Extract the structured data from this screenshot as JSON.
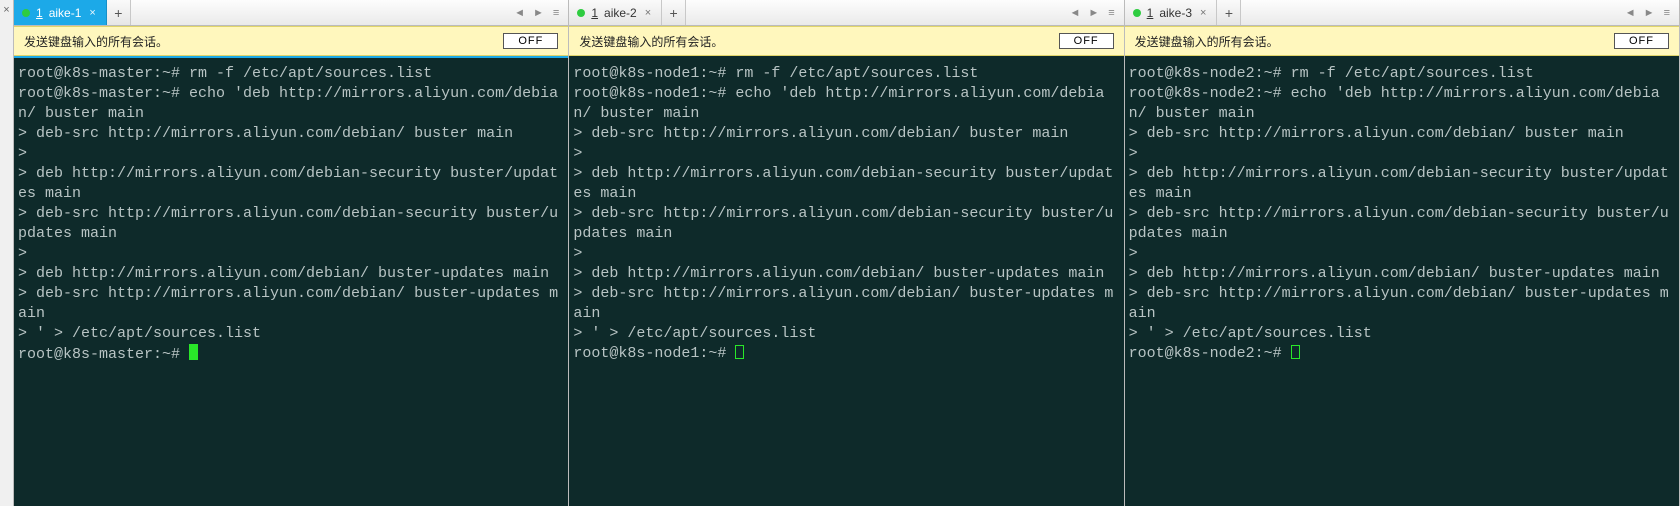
{
  "leftGutterClose": "×",
  "tabArrows": {
    "left": "◄",
    "right": "►",
    "menu": "≡"
  },
  "newTab": "+",
  "tabClose": "×",
  "panes": [
    {
      "focused": true,
      "tab": {
        "num": "1",
        "label": "aike-1"
      },
      "banner": {
        "message": "发送键盘输入的所有会话。",
        "button": "OFF"
      },
      "cursor": "block",
      "lines": [
        "root@k8s-master:~# rm -f /etc/apt/sources.list",
        "root@k8s-master:~# echo 'deb http://mirrors.aliyun.com/debian/ buster main",
        "> deb-src http://mirrors.aliyun.com/debian/ buster main",
        ">",
        "> deb http://mirrors.aliyun.com/debian-security buster/updates main",
        "> deb-src http://mirrors.aliyun.com/debian-security buster/updates main",
        ">",
        "> deb http://mirrors.aliyun.com/debian/ buster-updates main",
        "> deb-src http://mirrors.aliyun.com/debian/ buster-updates main",
        "> ' > /etc/apt/sources.list"
      ],
      "finalPrompt": "root@k8s-master:~# "
    },
    {
      "focused": false,
      "tab": {
        "num": "1",
        "label": "aike-2"
      },
      "banner": {
        "message": "发送键盘输入的所有会话。",
        "button": "OFF"
      },
      "cursor": "outline",
      "lines": [
        "root@k8s-node1:~# rm -f /etc/apt/sources.list",
        "root@k8s-node1:~# echo 'deb http://mirrors.aliyun.com/debian/ buster main",
        "> deb-src http://mirrors.aliyun.com/debian/ buster main",
        ">",
        "> deb http://mirrors.aliyun.com/debian-security buster/updates main",
        "> deb-src http://mirrors.aliyun.com/debian-security buster/updates main",
        ">",
        "> deb http://mirrors.aliyun.com/debian/ buster-updates main",
        "> deb-src http://mirrors.aliyun.com/debian/ buster-updates main",
        "> ' > /etc/apt/sources.list"
      ],
      "finalPrompt": "root@k8s-node1:~# "
    },
    {
      "focused": false,
      "tab": {
        "num": "1",
        "label": "aike-3"
      },
      "banner": {
        "message": "发送键盘输入的所有会话。",
        "button": "OFF"
      },
      "cursor": "outline",
      "lines": [
        "root@k8s-node2:~# rm -f /etc/apt/sources.list",
        "root@k8s-node2:~# echo 'deb http://mirrors.aliyun.com/debian/ buster main",
        "> deb-src http://mirrors.aliyun.com/debian/ buster main",
        ">",
        "> deb http://mirrors.aliyun.com/debian-security buster/updates main",
        "> deb-src http://mirrors.aliyun.com/debian-security buster/updates main",
        ">",
        "> deb http://mirrors.aliyun.com/debian/ buster-updates main",
        "> deb-src http://mirrors.aliyun.com/debian/ buster-updates main",
        "> ' > /etc/apt/sources.list"
      ],
      "finalPrompt": "root@k8s-node2:~# "
    }
  ]
}
